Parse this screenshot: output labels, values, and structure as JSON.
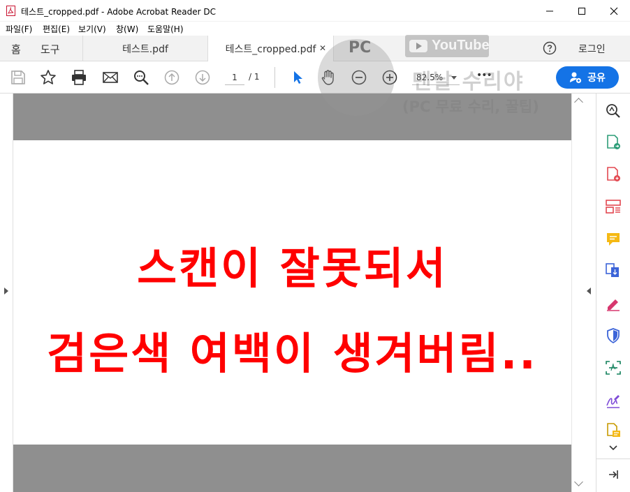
{
  "window": {
    "title": "테스트_cropped.pdf - Adobe Acrobat Reader DC"
  },
  "menu": {
    "items": [
      "파일(F)",
      "편집(E)",
      "보기(V)",
      "창(W)",
      "도움말(H)"
    ]
  },
  "nav": {
    "home": "홈",
    "tools": "도구",
    "tabs": [
      {
        "label": "테스트.pdf",
        "active": false
      },
      {
        "label": "테스트_cropped.pdf",
        "active": true
      }
    ],
    "login": "로그인"
  },
  "toolbar": {
    "page_current": "1",
    "page_total": "/ 1",
    "zoom": "82.5%",
    "share_label": "공유",
    "more": "•••"
  },
  "document": {
    "line1": "스캔이 잘못되서",
    "line2": "검은색 여백이 생겨버림.."
  },
  "watermark": {
    "badge": "PC",
    "platform": "YouTube",
    "channel": "맨날 수리야",
    "subtitle": "(PC 무료 수리, 꿀팁)"
  },
  "colors": {
    "accent": "#1473e6",
    "doc_text": "#ff0000",
    "gray_margin": "#8f8f8f"
  },
  "icons": {
    "right_panel": [
      "enhance-scan-icon",
      "export-pdf-icon",
      "create-pdf-icon",
      "organize-pages-icon",
      "comment-icon",
      "combine-files-icon",
      "fill-sign-icon",
      "protect-icon",
      "scan-ocr-icon",
      "request-signature-icon",
      "more-tools-icon"
    ]
  }
}
